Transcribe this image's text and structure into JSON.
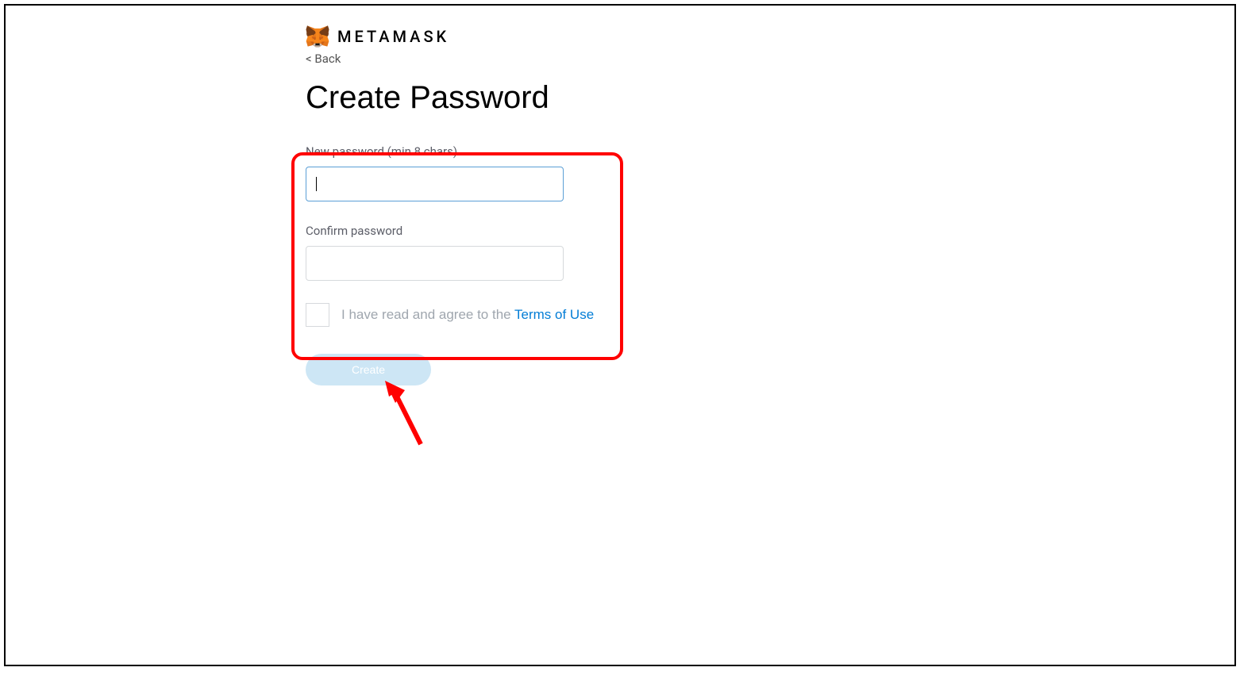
{
  "brand": {
    "name": "METAMASK"
  },
  "nav": {
    "back_label": "< Back"
  },
  "page": {
    "title": "Create Password"
  },
  "form": {
    "new_password_label": "New password (min 8 chars)",
    "new_password_value": "",
    "confirm_password_label": "Confirm password",
    "confirm_password_value": "",
    "terms_prefix": "I have read and agree to the ",
    "terms_link_text": "Terms of Use",
    "create_button_label": "Create"
  }
}
